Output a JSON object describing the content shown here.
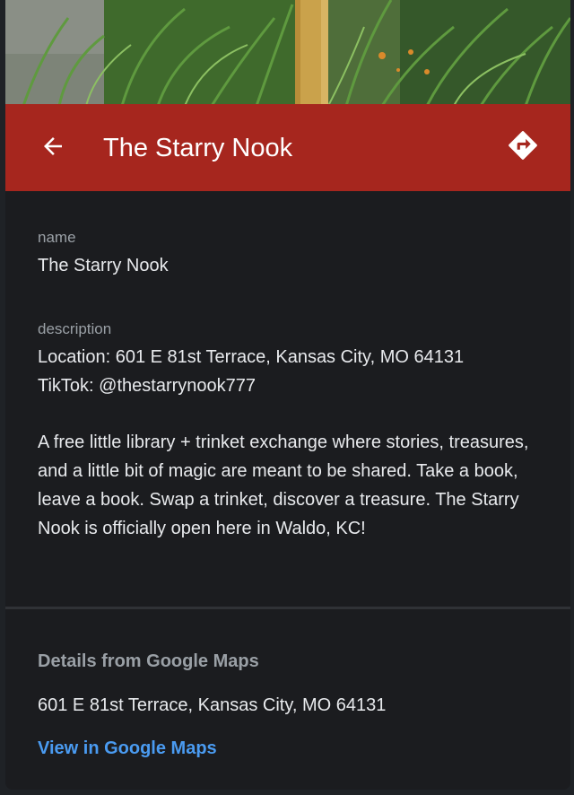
{
  "header": {
    "title": "The Starry Nook",
    "back_icon": "arrow-back-icon",
    "directions_icon": "directions-icon",
    "accent_color": "#a6261e"
  },
  "details": {
    "name_label": "name",
    "name_value": "The Starry Nook",
    "description_label": "description",
    "description_lines": [
      "Location: 601 E 81st Terrace, Kansas City, MO 64131",
      "TikTok: @thestarrynook777"
    ],
    "description_paragraph": "A free little library + trinket exchange where stories, treasures, and a little bit of magic are meant to be shared. Take a book, leave a book. Swap a trinket, discover a treasure. The Starry Nook is officially open here in Waldo, KC!"
  },
  "google_maps": {
    "heading": "Details from Google Maps",
    "address": "601 E 81st Terrace, Kansas City, MO 64131",
    "link_label": "View in Google Maps",
    "link_color": "#4a9bf1"
  }
}
